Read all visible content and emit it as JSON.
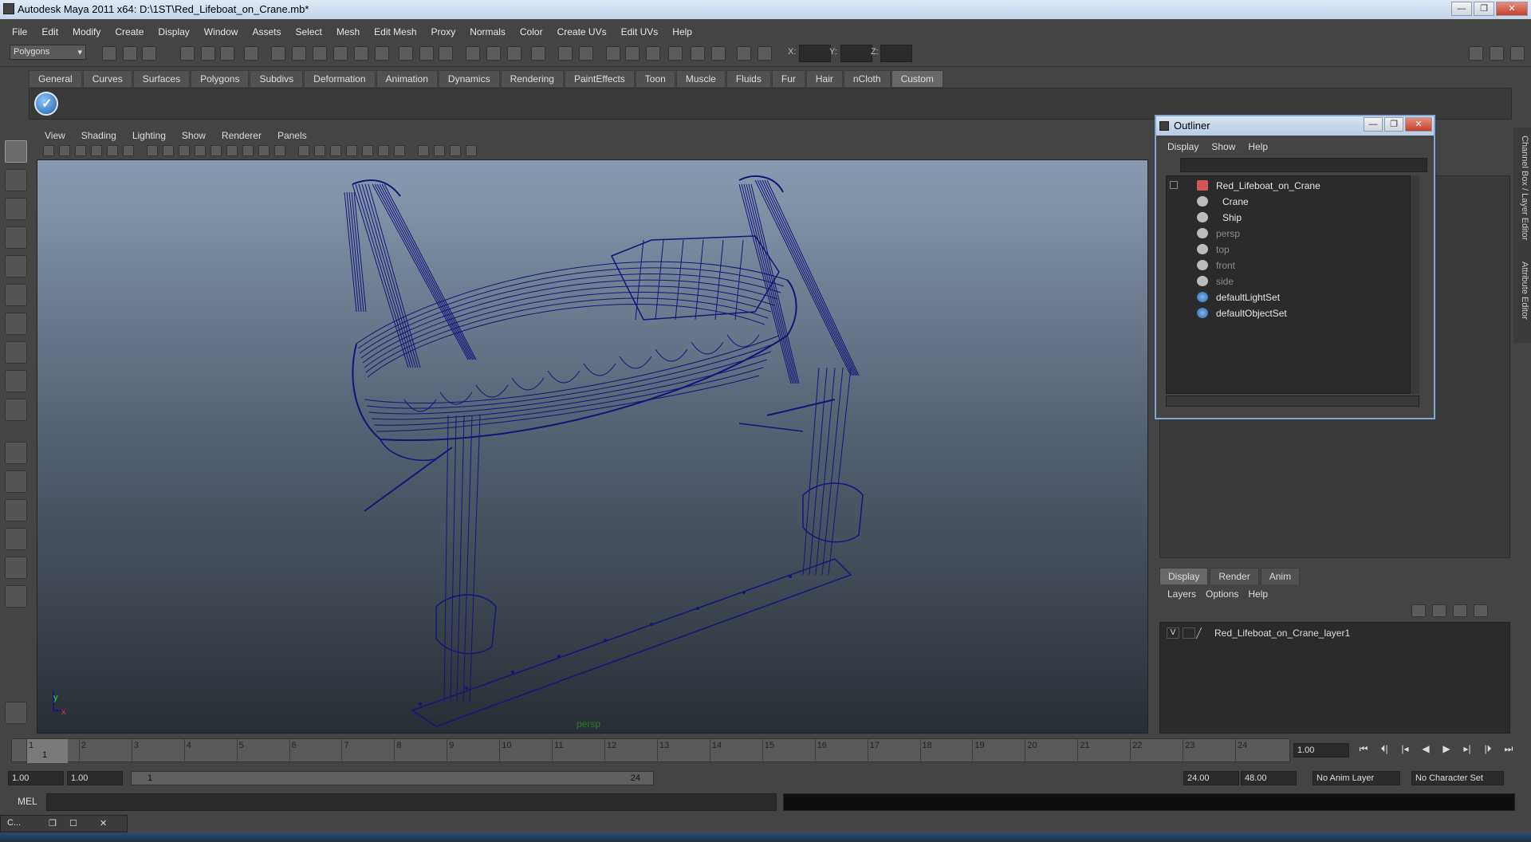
{
  "window": {
    "title": "Autodesk Maya 2011 x64: D:\\1ST\\Red_Lifeboat_on_Crane.mb*"
  },
  "menubar": [
    "File",
    "Edit",
    "Modify",
    "Create",
    "Display",
    "Window",
    "Assets",
    "Select",
    "Mesh",
    "Edit Mesh",
    "Proxy",
    "Normals",
    "Color",
    "Create UVs",
    "Edit UVs",
    "Help"
  ],
  "statusline": {
    "mode": "Polygons",
    "x_label": "X:",
    "y_label": "Y:",
    "z_label": "Z:"
  },
  "shelf_tabs": [
    "General",
    "Curves",
    "Surfaces",
    "Polygons",
    "Subdivs",
    "Deformation",
    "Animation",
    "Dynamics",
    "Rendering",
    "PaintEffects",
    "Toon",
    "Muscle",
    "Fluids",
    "Fur",
    "Hair",
    "nCloth",
    "Custom"
  ],
  "shelf_active": "Custom",
  "viewport": {
    "menu": [
      "View",
      "Shading",
      "Lighting",
      "Show",
      "Renderer",
      "Panels"
    ],
    "camera": "persp",
    "axis_x": "x",
    "axis_y": "y",
    "wire_color": "#14147a"
  },
  "outliner": {
    "title": "Outliner",
    "menu": [
      "Display",
      "Show",
      "Help"
    ],
    "items": [
      {
        "label": "Red_Lifeboat_on_Crane",
        "dim": false
      },
      {
        "label": "Crane",
        "dim": false
      },
      {
        "label": "Ship",
        "dim": false
      },
      {
        "label": "persp",
        "dim": true
      },
      {
        "label": "top",
        "dim": true
      },
      {
        "label": "front",
        "dim": true
      },
      {
        "label": "side",
        "dim": true
      },
      {
        "label": "defaultLightSet",
        "dim": false
      },
      {
        "label": "defaultObjectSet",
        "dim": false
      }
    ]
  },
  "side_tabs": {
    "channel_box": "Channel Box / Layer Editor",
    "attribute_editor": "Attribute Editor"
  },
  "layer_editor": {
    "tabs": [
      "Display",
      "Render",
      "Anim"
    ],
    "menu": [
      "Layers",
      "Options",
      "Help"
    ],
    "layer": {
      "visible": "V",
      "name": "Red_Lifeboat_on_Crane_layer1"
    }
  },
  "timeline": {
    "ticks": [
      "1",
      "2",
      "3",
      "4",
      "5",
      "6",
      "7",
      "8",
      "9",
      "10",
      "11",
      "12",
      "13",
      "14",
      "15",
      "16",
      "17",
      "18",
      "19",
      "20",
      "21",
      "22",
      "23",
      "24"
    ],
    "current_frame": "1",
    "current_field": "1.00"
  },
  "range": {
    "start": "1.00",
    "start2": "1.00",
    "bar_start": "1",
    "bar_end": "24",
    "end": "24.00",
    "end2": "48.00",
    "anim_layer": "No Anim Layer",
    "character_set": "No Character Set"
  },
  "cmdline": {
    "label": "MEL"
  },
  "minimized": {
    "label": "C..."
  }
}
